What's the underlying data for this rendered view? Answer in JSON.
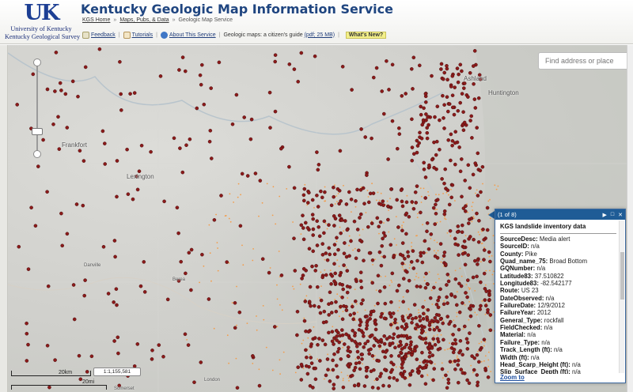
{
  "header": {
    "logo_mark": "UK",
    "logo_line1": "University of Kentucky",
    "logo_line2": "Kentucky Geological Survey",
    "title": "Kentucky Geologic Map Information Service",
    "breadcrumb": [
      "KGS Home",
      "Maps, Pubs, & Data",
      "Geologic Map Service"
    ]
  },
  "toolbar": {
    "feedback": "Feedback",
    "tutorials": "Tutorials",
    "about": "About This Service",
    "guide_text": "Geologic maps: a citizen's guide",
    "guide_link": "(pdf; 25 MB)",
    "whats_new": "What's New?"
  },
  "search": {
    "placeholder": "Find address or place"
  },
  "map": {
    "cities": {
      "ashland": "Ashland",
      "huntington": "Huntington",
      "frankfort": "Frankfort",
      "lexington": "Lexington",
      "danville": "Danville",
      "berea": "Berea",
      "london": "London",
      "somerset": "Somerset"
    },
    "scale": {
      "km": "20km",
      "mi": "20mi",
      "ratio": "1:1,155,581"
    },
    "colors": {
      "point": "#8b1a1a",
      "landslide_area": "#f39c4a"
    }
  },
  "popup": {
    "counter": "(1 of 8)",
    "title": "KGS landslide inventory data",
    "fields": [
      {
        "k": "SourceDesc:",
        "v": "Media alert"
      },
      {
        "k": "SourceID:",
        "v": "n/a"
      },
      {
        "k": "County:",
        "v": "Pike"
      },
      {
        "k": "Quad_name_75:",
        "v": "Broad Bottom"
      },
      {
        "k": "GQNumber:",
        "v": "n/a"
      },
      {
        "k": "Latitude83:",
        "v": "37.510822"
      },
      {
        "k": "Longitude83:",
        "v": "-82.542177"
      },
      {
        "k": "Route:",
        "v": "US 23"
      },
      {
        "k": "DateObserved:",
        "v": "n/a"
      },
      {
        "k": "FailureDate:",
        "v": "12/9/2012"
      },
      {
        "k": "FailureYear:",
        "v": "2012"
      },
      {
        "k": "General_Type:",
        "v": "rockfall"
      },
      {
        "k": "FieldChecked:",
        "v": "n/a"
      },
      {
        "k": "Material:",
        "v": "n/a"
      },
      {
        "k": "Failure_Type:",
        "v": "n/a"
      },
      {
        "k": "Track_Length (ft):",
        "v": "n/a"
      },
      {
        "k": "Width (ft):",
        "v": "n/a"
      },
      {
        "k": "Head_Scarp_Height (ft):",
        "v": "n/a"
      },
      {
        "k": "Slip_Surface_Depth (ft):",
        "v": "n/a"
      }
    ],
    "zoom_link": "Zoom to"
  }
}
